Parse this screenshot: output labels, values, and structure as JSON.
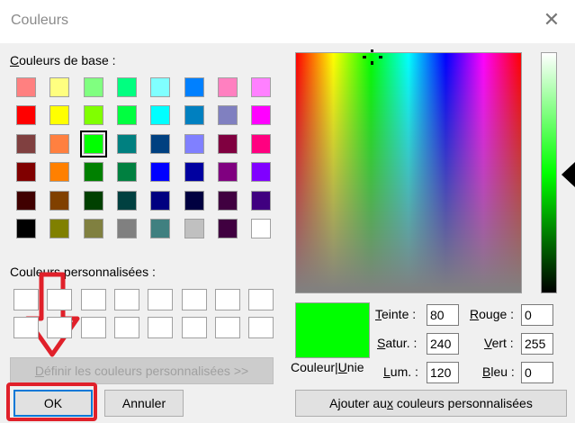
{
  "window": {
    "title": "Couleurs",
    "close_glyph": "✕"
  },
  "basic": {
    "label": "ouleurs de base :",
    "label_mnemonic": "C",
    "selected": "#00ff00",
    "colors": [
      [
        "#ff8080",
        "#ffff80",
        "#80ff80",
        "#00ff80",
        "#80ffff",
        "#0080ff",
        "#ff80c0",
        "#ff80ff"
      ],
      [
        "#ff0000",
        "#ffff00",
        "#80ff00",
        "#00ff40",
        "#00ffff",
        "#0080c0",
        "#8080c0",
        "#ff00ff"
      ],
      [
        "#804040",
        "#ff8040",
        "#00ff00",
        "#008080",
        "#004080",
        "#8080ff",
        "#800040",
        "#ff0080"
      ],
      [
        "#800000",
        "#ff8000",
        "#008000",
        "#008040",
        "#0000ff",
        "#0000a0",
        "#800080",
        "#8000ff"
      ],
      [
        "#400000",
        "#804000",
        "#004000",
        "#004040",
        "#000080",
        "#000040",
        "#400040",
        "#400080"
      ],
      [
        "#000000",
        "#808000",
        "#808040",
        "#808080",
        "#408080",
        "#c0c0c0",
        "#400040",
        "#ffffff"
      ]
    ]
  },
  "custom": {
    "label": "Couleurs personnalisées :",
    "rows": 2,
    "cols": 8
  },
  "define_button": {
    "label_mnemonic": "D",
    "label": "éfinir les couleurs personnalisées >>"
  },
  "ok_button": {
    "label": "OK"
  },
  "cancel_button": {
    "label": "Annuler"
  },
  "preview": {
    "label_a": "Couleur",
    "label_b_mnemonic": "U",
    "label_b": "nie",
    "color": "#00ff00"
  },
  "fields": {
    "teinte": {
      "mn": "T",
      "rest": "einte :",
      "value": "80"
    },
    "satur": {
      "mn": "S",
      "rest": "atur. :",
      "value": "240"
    },
    "lum": {
      "mn": "L",
      "rest": "um. :",
      "value": "120"
    },
    "rouge": {
      "mn": "R",
      "rest": "ouge :",
      "value": "0"
    },
    "vert": {
      "mn": "V",
      "rest": "ert :",
      "value": "255"
    },
    "bleu": {
      "mn": "B",
      "rest": "leu :",
      "value": "0"
    }
  },
  "add_button": {
    "label_a": "Ajouter au",
    "label_mn": "x",
    "label_b": " couleurs personnalisées"
  },
  "colors": {
    "annotation_red": "#e0202a",
    "accent_green": "#00ff00"
  },
  "icons": {
    "close": "close-icon",
    "spectrum_cursor": "crosshair-icon",
    "luminance_pointer": "triangle-left-icon",
    "annotation": "down-arrow-icon"
  }
}
